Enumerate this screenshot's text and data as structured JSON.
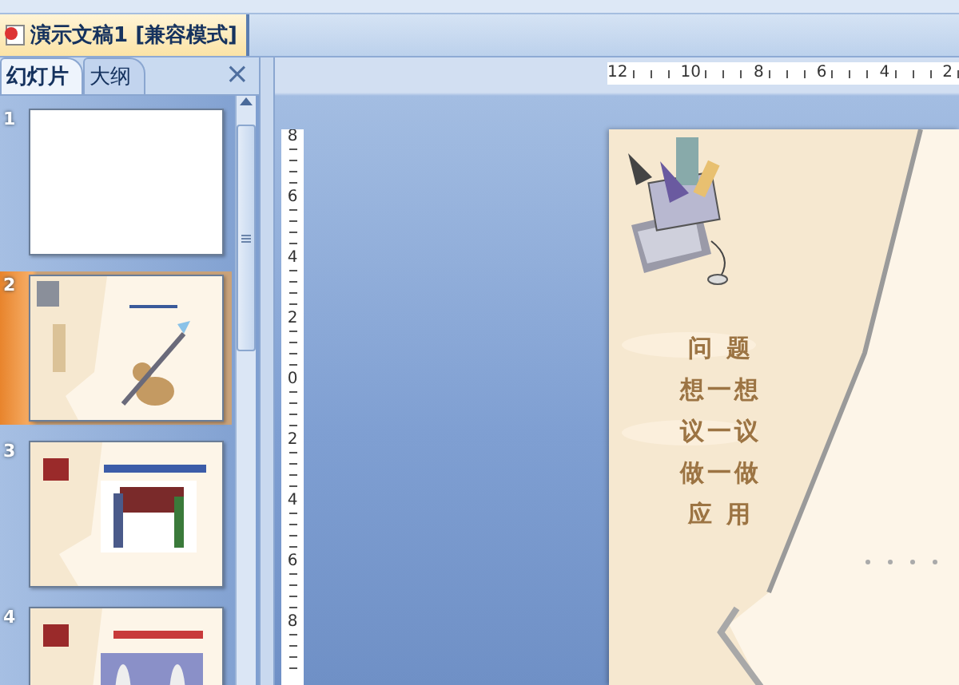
{
  "document_tab": {
    "title": "演示文稿1 [兼容模式]",
    "selected": true
  },
  "pane_tabs": [
    {
      "label": "幻灯片",
      "selected": true
    },
    {
      "label": "大纲",
      "selected": false
    }
  ],
  "pane_close": "×",
  "slides": [
    {
      "number": "1",
      "kind": "blank",
      "selected": false
    },
    {
      "number": "2",
      "kind": "squirrel",
      "selected": true
    },
    {
      "number": "3",
      "kind": "classroom",
      "selected": false
    },
    {
      "number": "4",
      "kind": "figures",
      "selected": false
    }
  ],
  "horizontal_ruler": [
    "12",
    "10",
    "8",
    "6",
    "4",
    "2"
  ],
  "vertical_ruler": [
    "8",
    "6",
    "4",
    "2",
    "0",
    "2",
    "4",
    "6",
    "8"
  ],
  "slide": {
    "menu": [
      "问 题",
      "想一想",
      "议一议",
      "做一做",
      "应 用"
    ]
  }
}
